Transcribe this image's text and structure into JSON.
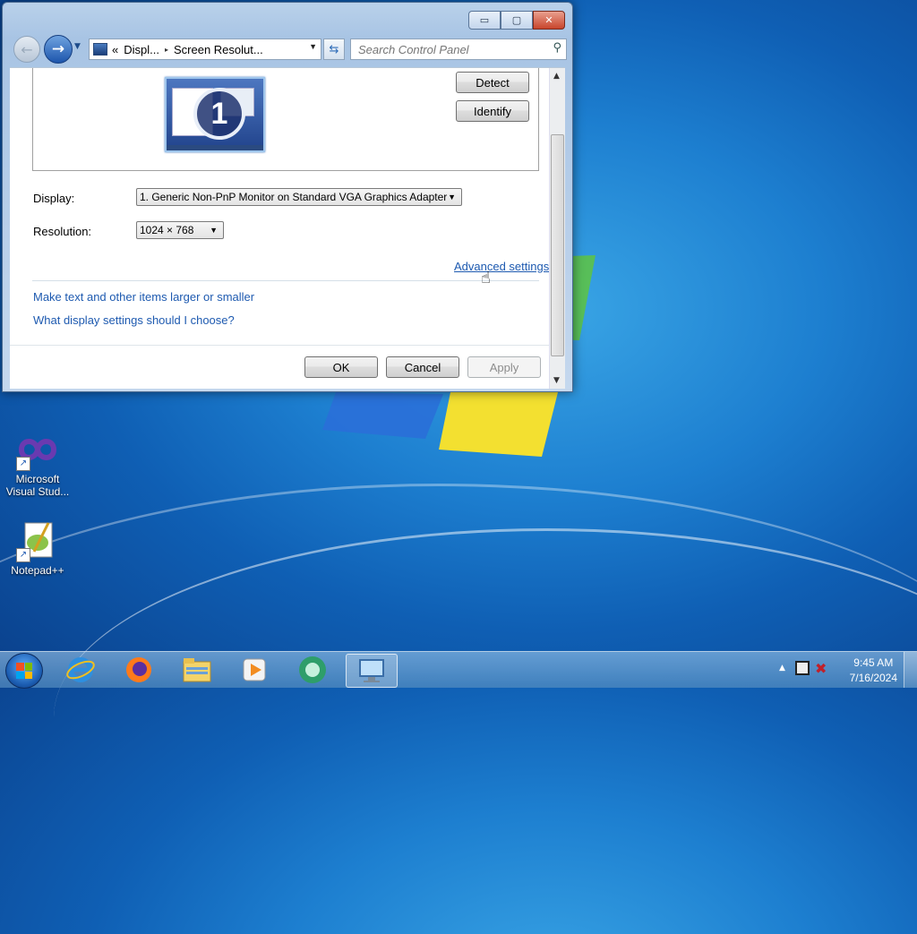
{
  "window": {
    "caption_buttons": {
      "minimize": "▭",
      "maximize": "▢",
      "close": "✕"
    },
    "address": {
      "chevron": "«",
      "crumb1": "Displ...",
      "separator": "▸",
      "crumb2": "Screen Resolut...",
      "refresh_symbol": "⇆"
    },
    "search_placeholder": "Search Control Panel",
    "detect_label": "Detect",
    "identify_label": "Identify",
    "monitor_number": "1",
    "display_label": "Display:",
    "display_value": "1. Generic Non-PnP Monitor on Standard VGA Graphics Adapter",
    "resolution_label": "Resolution:",
    "resolution_value": "1024 × 768",
    "advanced_link": "Advanced settings",
    "link_text_size": "Make text and other items larger or smaller",
    "link_which_settings": "What display settings should I choose?",
    "ok_label": "OK",
    "cancel_label": "Cancel",
    "apply_label": "Apply"
  },
  "desktop_icons": [
    {
      "label_line1": "Microsoft",
      "label_line2": "Visual Stud...",
      "icon": "visual-studio-icon"
    },
    {
      "label_line1": "Notepad++",
      "label_line2": "",
      "icon": "notepad-plus-plus-icon"
    }
  ],
  "taskbar": {
    "items": [
      "internet-explorer-icon",
      "firefox-icon",
      "file-explorer-icon",
      "media-player-icon",
      "app-green-icon",
      "control-panel-icon"
    ],
    "clock_time": "9:45 AM",
    "clock_date": "7/16/2024",
    "tray_chevron": "▲"
  },
  "colors": {
    "accent_link": "#1e5ab0",
    "desktop_blue": "#1d7fd0",
    "close_red": "#c8452c"
  }
}
